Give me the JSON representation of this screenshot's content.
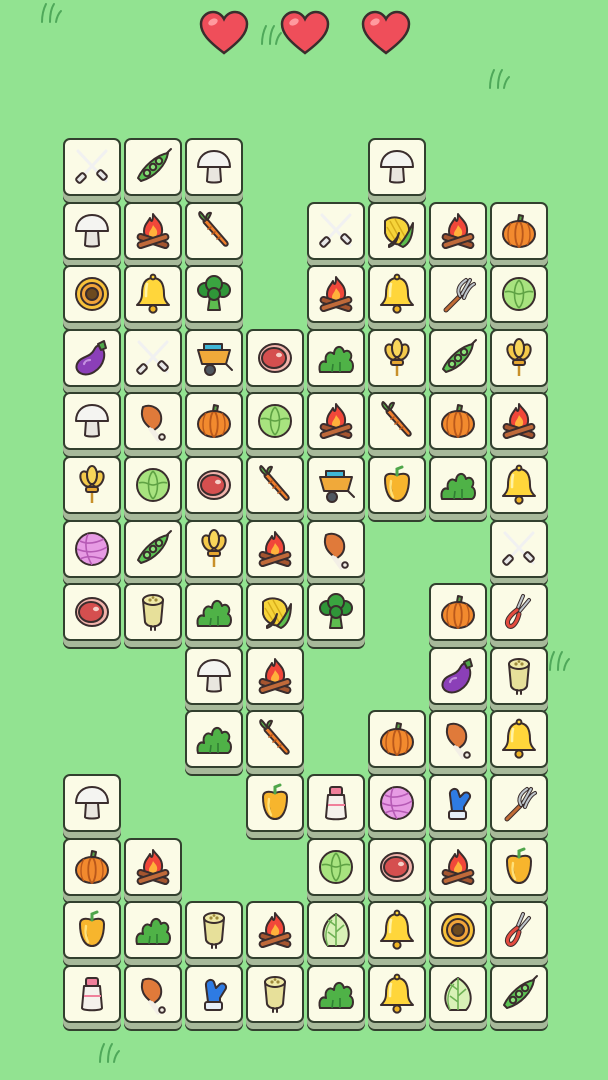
{
  "game": {
    "lives": 3,
    "lives_label": "3"
  },
  "colors": {
    "background": "#92e391",
    "tile_face": "#fbfbe6",
    "tile_border": "#32402e",
    "heart": "#ef4e5a"
  },
  "tiles": [
    {
      "icon": "fork-knife-icon",
      "col": 0,
      "row": 0
    },
    {
      "icon": "pea-pod-icon",
      "col": 1,
      "row": 0
    },
    {
      "icon": "mushroom-icon",
      "col": 2,
      "row": 0
    },
    {
      "icon": "mushroom-icon",
      "col": 5,
      "row": 0
    },
    {
      "icon": "mushroom-icon",
      "col": 0,
      "row": 1
    },
    {
      "icon": "campfire-icon",
      "col": 1,
      "row": 1
    },
    {
      "icon": "carrot-icon",
      "col": 2,
      "row": 1
    },
    {
      "icon": "fork-knife-icon",
      "col": 4,
      "row": 1
    },
    {
      "icon": "corn-icon",
      "col": 5,
      "row": 1
    },
    {
      "icon": "campfire-icon",
      "col": 6,
      "row": 1
    },
    {
      "icon": "pumpkin-icon",
      "col": 7,
      "row": 1
    },
    {
      "icon": "pumpkin-slice-icon",
      "col": 0,
      "row": 2
    },
    {
      "icon": "bell-icon",
      "col": 1,
      "row": 2
    },
    {
      "icon": "broccoli-icon",
      "col": 2,
      "row": 2
    },
    {
      "icon": "campfire-icon",
      "col": 4,
      "row": 2
    },
    {
      "icon": "bell-icon",
      "col": 5,
      "row": 2
    },
    {
      "icon": "pitchfork-icon",
      "col": 6,
      "row": 2
    },
    {
      "icon": "cabbage-icon",
      "col": 7,
      "row": 2
    },
    {
      "icon": "eggplant-icon",
      "col": 0,
      "row": 3
    },
    {
      "icon": "fork-knife-icon",
      "col": 1,
      "row": 3
    },
    {
      "icon": "wheelbarrow-icon",
      "col": 2,
      "row": 3
    },
    {
      "icon": "meat-icon",
      "col": 3,
      "row": 3
    },
    {
      "icon": "bush-icon",
      "col": 4,
      "row": 3
    },
    {
      "icon": "wheat-icon",
      "col": 5,
      "row": 3
    },
    {
      "icon": "pea-pod-icon",
      "col": 6,
      "row": 3
    },
    {
      "icon": "wheat-icon",
      "col": 7,
      "row": 3
    },
    {
      "icon": "mushroom-icon",
      "col": 0,
      "row": 4
    },
    {
      "icon": "chicken-leg-icon",
      "col": 1,
      "row": 4
    },
    {
      "icon": "pumpkin-icon",
      "col": 2,
      "row": 4
    },
    {
      "icon": "cabbage-icon",
      "col": 3,
      "row": 4
    },
    {
      "icon": "campfire-icon",
      "col": 4,
      "row": 4
    },
    {
      "icon": "carrot-icon",
      "col": 5,
      "row": 4
    },
    {
      "icon": "pumpkin-icon",
      "col": 6,
      "row": 4
    },
    {
      "icon": "campfire-icon",
      "col": 7,
      "row": 4
    },
    {
      "icon": "wheat-icon",
      "col": 0,
      "row": 5
    },
    {
      "icon": "cabbage-icon",
      "col": 1,
      "row": 5
    },
    {
      "icon": "meat-icon",
      "col": 2,
      "row": 5
    },
    {
      "icon": "carrot-icon",
      "col": 3,
      "row": 5
    },
    {
      "icon": "wheelbarrow-icon",
      "col": 4,
      "row": 5
    },
    {
      "icon": "bell-pepper-icon",
      "col": 5,
      "row": 5
    },
    {
      "icon": "bush-icon",
      "col": 6,
      "row": 5
    },
    {
      "icon": "bell-icon",
      "col": 7,
      "row": 5
    },
    {
      "icon": "yarn-ball-icon",
      "col": 0,
      "row": 6
    },
    {
      "icon": "pea-pod-icon",
      "col": 1,
      "row": 6
    },
    {
      "icon": "wheat-icon",
      "col": 2,
      "row": 6
    },
    {
      "icon": "campfire-icon",
      "col": 3,
      "row": 6
    },
    {
      "icon": "chicken-leg-icon",
      "col": 4,
      "row": 6
    },
    {
      "icon": "fork-knife-icon",
      "col": 7,
      "row": 6
    },
    {
      "icon": "meat-icon",
      "col": 0,
      "row": 7
    },
    {
      "icon": "lotus-root-icon",
      "col": 1,
      "row": 7
    },
    {
      "icon": "bush-icon",
      "col": 2,
      "row": 7
    },
    {
      "icon": "corn-icon",
      "col": 3,
      "row": 7
    },
    {
      "icon": "broccoli-icon",
      "col": 4,
      "row": 7
    },
    {
      "icon": "pumpkin-icon",
      "col": 6,
      "row": 7
    },
    {
      "icon": "pruning-shears-icon",
      "col": 7,
      "row": 7
    },
    {
      "icon": "mushroom-icon",
      "col": 2,
      "row": 8
    },
    {
      "icon": "campfire-icon",
      "col": 3,
      "row": 8
    },
    {
      "icon": "eggplant-icon",
      "col": 6,
      "row": 8
    },
    {
      "icon": "lotus-root-icon",
      "col": 7,
      "row": 8
    },
    {
      "icon": "bush-icon",
      "col": 2,
      "row": 9
    },
    {
      "icon": "carrot-icon",
      "col": 3,
      "row": 9
    },
    {
      "icon": "pumpkin-icon",
      "col": 5,
      "row": 9
    },
    {
      "icon": "chicken-leg-icon",
      "col": 6,
      "row": 9
    },
    {
      "icon": "bell-icon",
      "col": 7,
      "row": 9
    },
    {
      "icon": "mushroom-icon",
      "col": 0,
      "row": 10
    },
    {
      "icon": "bell-pepper-icon",
      "col": 3,
      "row": 10
    },
    {
      "icon": "milk-bottle-icon",
      "col": 4,
      "row": 10
    },
    {
      "icon": "yarn-ball-icon",
      "col": 5,
      "row": 10
    },
    {
      "icon": "mitten-icon",
      "col": 6,
      "row": 10
    },
    {
      "icon": "pitchfork-icon",
      "col": 7,
      "row": 10
    },
    {
      "icon": "pumpkin-icon",
      "col": 0,
      "row": 11
    },
    {
      "icon": "campfire-icon",
      "col": 1,
      "row": 11
    },
    {
      "icon": "cabbage-icon",
      "col": 4,
      "row": 11
    },
    {
      "icon": "meat-icon",
      "col": 5,
      "row": 11
    },
    {
      "icon": "campfire-icon",
      "col": 6,
      "row": 11
    },
    {
      "icon": "bell-pepper-icon",
      "col": 7,
      "row": 11
    },
    {
      "icon": "bell-pepper-icon",
      "col": 0,
      "row": 12
    },
    {
      "icon": "bush-icon",
      "col": 1,
      "row": 12
    },
    {
      "icon": "lotus-root-icon",
      "col": 2,
      "row": 12
    },
    {
      "icon": "campfire-icon",
      "col": 3,
      "row": 12
    },
    {
      "icon": "napa-cabbage-icon",
      "col": 4,
      "row": 12
    },
    {
      "icon": "bell-icon",
      "col": 5,
      "row": 12
    },
    {
      "icon": "pumpkin-slice-icon",
      "col": 6,
      "row": 12
    },
    {
      "icon": "pruning-shears-icon",
      "col": 7,
      "row": 12
    },
    {
      "icon": "milk-bottle-icon",
      "col": 0,
      "row": 13
    },
    {
      "icon": "chicken-leg-icon",
      "col": 1,
      "row": 13
    },
    {
      "icon": "mitten-icon",
      "col": 2,
      "row": 13
    },
    {
      "icon": "lotus-root-icon",
      "col": 3,
      "row": 13
    },
    {
      "icon": "bush-icon",
      "col": 4,
      "row": 13
    },
    {
      "icon": "bell-icon",
      "col": 5,
      "row": 13
    },
    {
      "icon": "napa-cabbage-icon",
      "col": 6,
      "row": 13
    },
    {
      "icon": "pea-pod-icon",
      "col": 7,
      "row": 13
    }
  ]
}
